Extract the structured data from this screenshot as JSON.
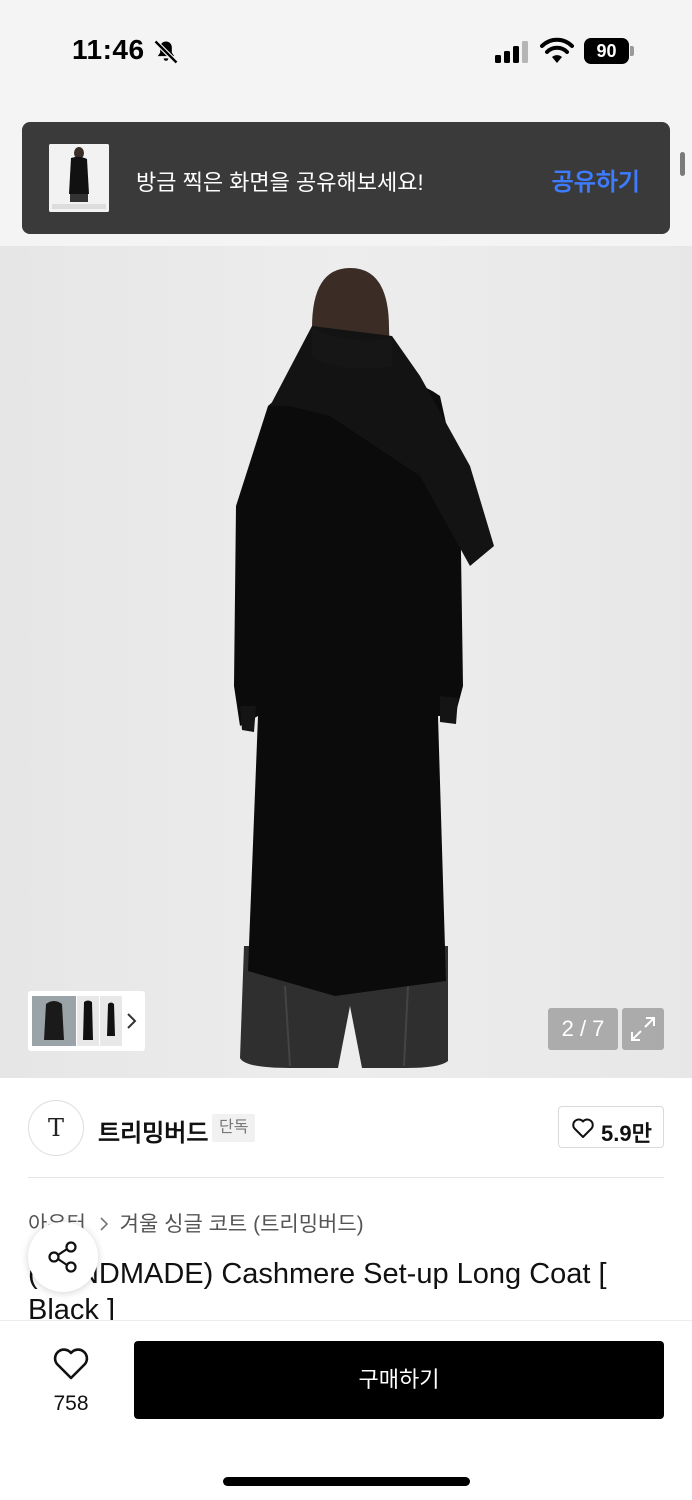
{
  "status_bar": {
    "time": "11:46",
    "battery": "90",
    "icons": [
      "bell-slash-icon",
      "cellular-signal-icon",
      "wifi-icon",
      "battery-icon"
    ]
  },
  "toast": {
    "message": "방금 찍은 화면을 공유해보세요!",
    "action_label": "공유하기",
    "action_color": "#3d7bff"
  },
  "gallery": {
    "counter": "2 / 7",
    "icons": [
      "chevron-right-icon",
      "expand-icon"
    ]
  },
  "brand": {
    "logo_letter": "T",
    "name": "트리밍버드",
    "badge": "단독",
    "like_count": "5.9만"
  },
  "product": {
    "breadcrumb": [
      "아우터",
      "겨울 싱글 코트 (트리밍버드)"
    ],
    "title": "(HANDMADE) Cashmere Set-up Long Coat [ Black ]"
  },
  "bottom_bar": {
    "wishlist_count": "758",
    "buy_label": "구매하기"
  }
}
